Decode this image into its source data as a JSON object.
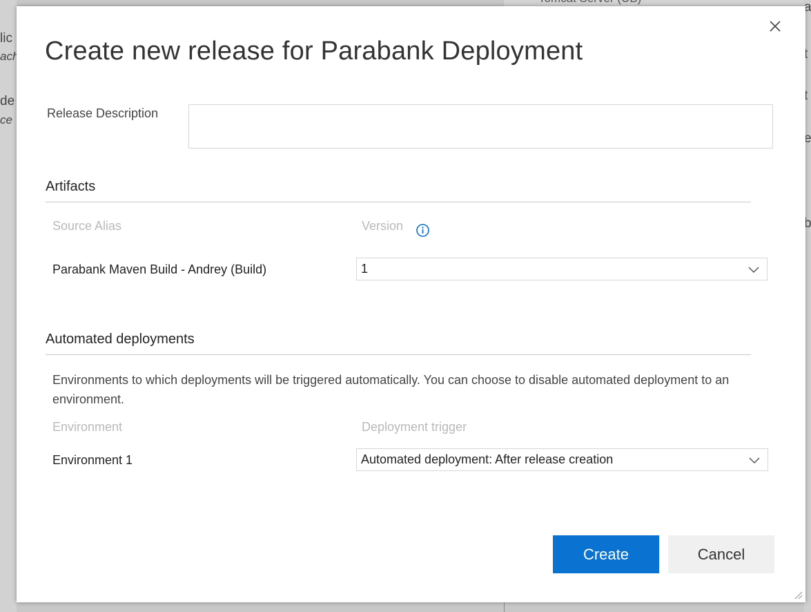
{
  "background": {
    "left_fragments": [
      "lic",
      "ach",
      "de",
      "ce"
    ],
    "top_fragment": "Tomcat Server (UB)",
    "right_fragments": [
      "a",
      "t",
      "t",
      "e",
      "b"
    ]
  },
  "dialog": {
    "title": "Create new release for Parabank Deployment",
    "close_icon": "close-icon",
    "description": {
      "label": "Release Description",
      "value": "",
      "placeholder": ""
    },
    "artifacts": {
      "heading": "Artifacts",
      "col_source_alias": "Source Alias",
      "col_version": "Version",
      "version_info_icon": "info-icon",
      "rows": [
        {
          "source_alias": "Parabank Maven Build - Andrey (Build)",
          "version": "1"
        }
      ]
    },
    "automated": {
      "heading": "Automated deployments",
      "help_text": "Environments to which deployments will be triggered automatically. You can choose to disable automated deployment to an environment.",
      "col_environment": "Environment",
      "col_trigger": "Deployment trigger",
      "rows": [
        {
          "environment": "Environment 1",
          "trigger": "Automated deployment: After release creation"
        }
      ]
    },
    "buttons": {
      "create": "Create",
      "cancel": "Cancel"
    }
  },
  "colors": {
    "primary": "#0a72d0",
    "overlay": "#9a9a9a",
    "muted_text": "#b9b9b9"
  }
}
